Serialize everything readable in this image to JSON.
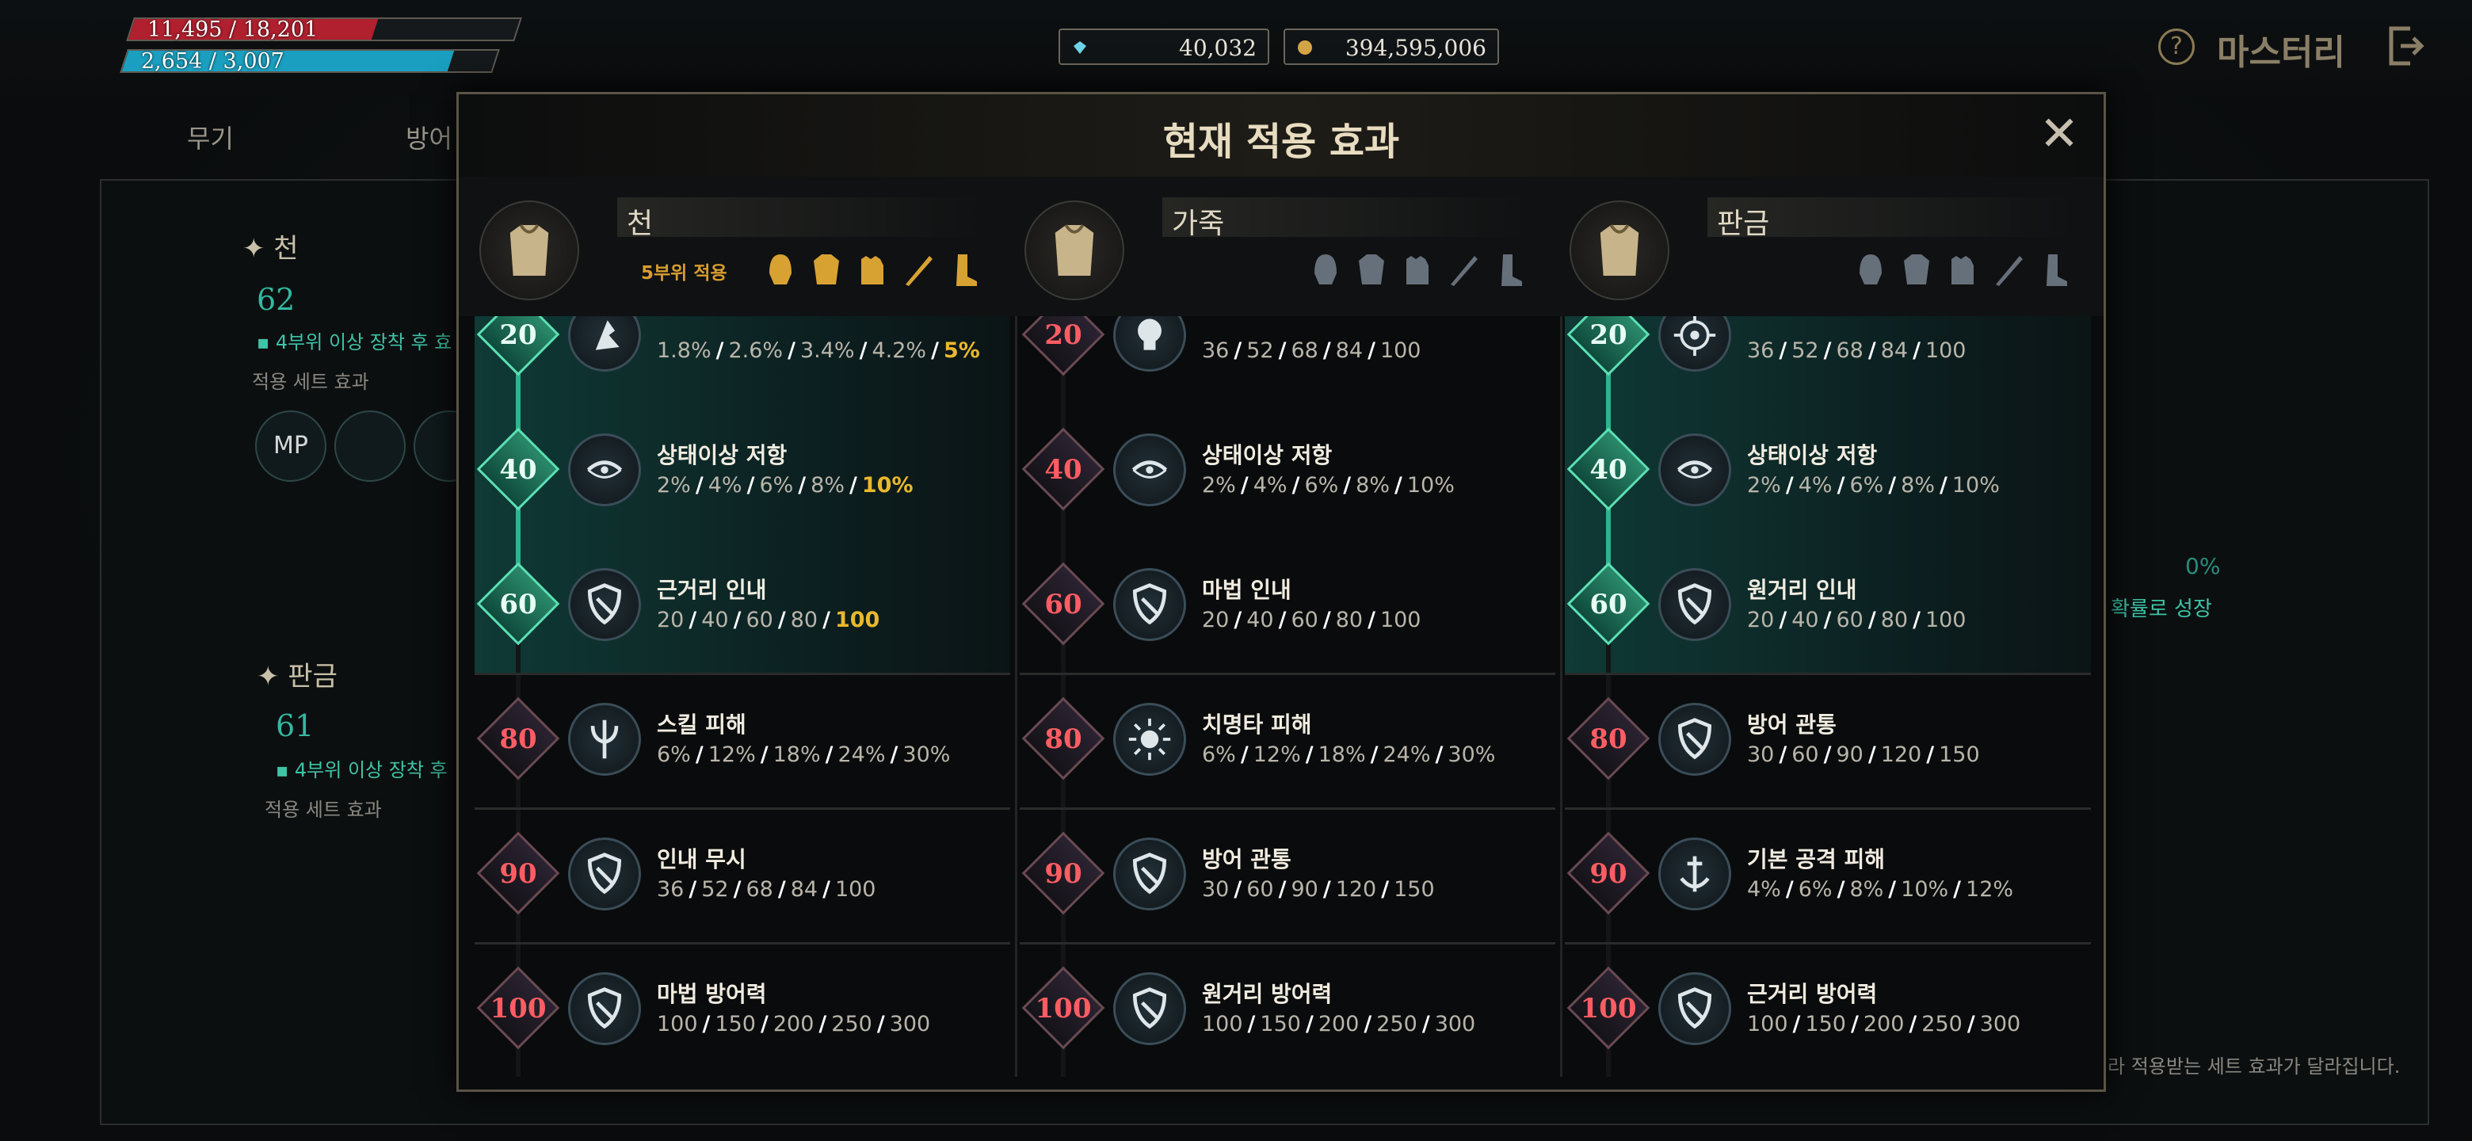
{
  "hud": {
    "hp_text": "11,495 / 18,201",
    "hp_fraction": 0.632,
    "mp_text": "2,654 / 3,007",
    "mp_fraction": 0.883,
    "hp_color": "#b0202e",
    "mp_color": "#1a9fc0",
    "gems": "40,032",
    "gold": "394,595,006",
    "menu_title": "마스터리"
  },
  "background": {
    "tabs": [
      "무기",
      "방어"
    ],
    "sections": [
      {
        "name": "천",
        "level": "62",
        "note": "4부위 이상 장착 후 효",
        "set_label": "적용 세트 효과",
        "buttons": [
          "MP"
        ]
      },
      {
        "name": "판금",
        "level": "61",
        "note": "4부위 이상 장착 후",
        "set_label": "적용 세트 효과"
      }
    ],
    "right_pct": "0%",
    "right_note": "확률로 성장",
    "footer_note": "라 적용받는 세트 효과가 달라집니다."
  },
  "modal": {
    "title": "현재 적용 효과",
    "columns": [
      {
        "name": "천",
        "applied_label": "5부위 적용",
        "active_count": 3,
        "entries": [
          {
            "level": "20",
            "name": "",
            "values": [
              "1.8%",
              "2.6%",
              "3.4%",
              "4.2%",
              "5%"
            ],
            "highlight": 4,
            "icon": "dash-icon"
          },
          {
            "level": "40",
            "name": "상태이상 저항",
            "values": [
              "2%",
              "4%",
              "6%",
              "8%",
              "10%"
            ],
            "highlight": 4,
            "icon": "swirl-icon"
          },
          {
            "level": "60",
            "name": "근거리 인내",
            "values": [
              "20",
              "40",
              "60",
              "80",
              "100"
            ],
            "highlight": 4,
            "icon": "shield-icon"
          },
          {
            "level": "80",
            "name": "스킬 피해",
            "values": [
              "6%",
              "12%",
              "18%",
              "24%",
              "30%"
            ],
            "highlight": -1,
            "icon": "trident-icon"
          },
          {
            "level": "90",
            "name": "인내 무시",
            "values": [
              "36",
              "52",
              "68",
              "84",
              "100"
            ],
            "highlight": -1,
            "icon": "shield-icon"
          },
          {
            "level": "100",
            "name": "마법 방어력",
            "values": [
              "100",
              "150",
              "200",
              "250",
              "300"
            ],
            "highlight": -1,
            "icon": "shield-icon"
          }
        ]
      },
      {
        "name": "가죽",
        "applied_label": "",
        "active_count": 0,
        "entries": [
          {
            "level": "20",
            "name": "",
            "values": [
              "36",
              "52",
              "68",
              "84",
              "100"
            ],
            "highlight": -1,
            "icon": "skull-icon"
          },
          {
            "level": "40",
            "name": "상태이상 저항",
            "values": [
              "2%",
              "4%",
              "6%",
              "8%",
              "10%"
            ],
            "highlight": -1,
            "icon": "swirl-icon"
          },
          {
            "level": "60",
            "name": "마법 인내",
            "values": [
              "20",
              "40",
              "60",
              "80",
              "100"
            ],
            "highlight": -1,
            "icon": "shield-icon"
          },
          {
            "level": "80",
            "name": "치명타 피해",
            "values": [
              "6%",
              "12%",
              "18%",
              "24%",
              "30%"
            ],
            "highlight": -1,
            "icon": "burst-icon"
          },
          {
            "level": "90",
            "name": "방어 관통",
            "values": [
              "30",
              "60",
              "90",
              "120",
              "150"
            ],
            "highlight": -1,
            "icon": "shield-icon"
          },
          {
            "level": "100",
            "name": "원거리 방어력",
            "values": [
              "100",
              "150",
              "200",
              "250",
              "300"
            ],
            "highlight": -1,
            "icon": "shield-icon"
          }
        ]
      },
      {
        "name": "판금",
        "applied_label": "",
        "active_count": 3,
        "entries": [
          {
            "level": "20",
            "name": "",
            "values": [
              "36",
              "52",
              "68",
              "84",
              "100"
            ],
            "highlight": -1,
            "icon": "target-icon"
          },
          {
            "level": "40",
            "name": "상태이상 저항",
            "values": [
              "2%",
              "4%",
              "6%",
              "8%",
              "10%"
            ],
            "highlight": -1,
            "icon": "swirl-icon"
          },
          {
            "level": "60",
            "name": "원거리 인내",
            "values": [
              "20",
              "40",
              "60",
              "80",
              "100"
            ],
            "highlight": -1,
            "icon": "shield-icon"
          },
          {
            "level": "80",
            "name": "방어 관통",
            "values": [
              "30",
              "60",
              "90",
              "120",
              "150"
            ],
            "highlight": -1,
            "icon": "shield-icon"
          },
          {
            "level": "90",
            "name": "기본 공격 피해",
            "values": [
              "4%",
              "6%",
              "8%",
              "10%",
              "12%"
            ],
            "highlight": -1,
            "icon": "anchor-icon"
          },
          {
            "level": "100",
            "name": "근거리 방어력",
            "values": [
              "100",
              "150",
              "200",
              "250",
              "300"
            ],
            "highlight": -1,
            "icon": "shield-icon"
          }
        ]
      }
    ]
  }
}
